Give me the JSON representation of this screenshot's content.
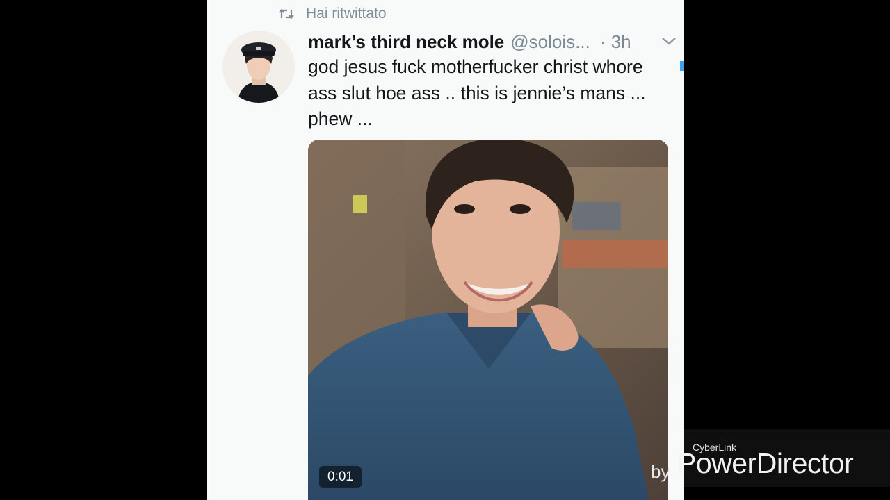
{
  "retweet": {
    "label": "Hai ritwittato"
  },
  "tweet": {
    "display_name": "mark’s third neck mole",
    "handle": "@solois...",
    "time": "· 3h",
    "text": "god jesus fuck motherfucker christ whore ass slut hoe ass .. this is jennie’s mans ... phew ...",
    "media": {
      "duration": "0:01"
    }
  },
  "watermark": {
    "brand_small": "CyberLink",
    "by": "by",
    "product": "PowerDirector"
  },
  "colors": {
    "panel_bg": "#f8f9f9",
    "text": "#14171a",
    "muted": "#7b8a95",
    "accent": "#3ea0f0"
  },
  "icons": {
    "retweet": "retweet-icon",
    "caret": "chevron-down-icon"
  }
}
